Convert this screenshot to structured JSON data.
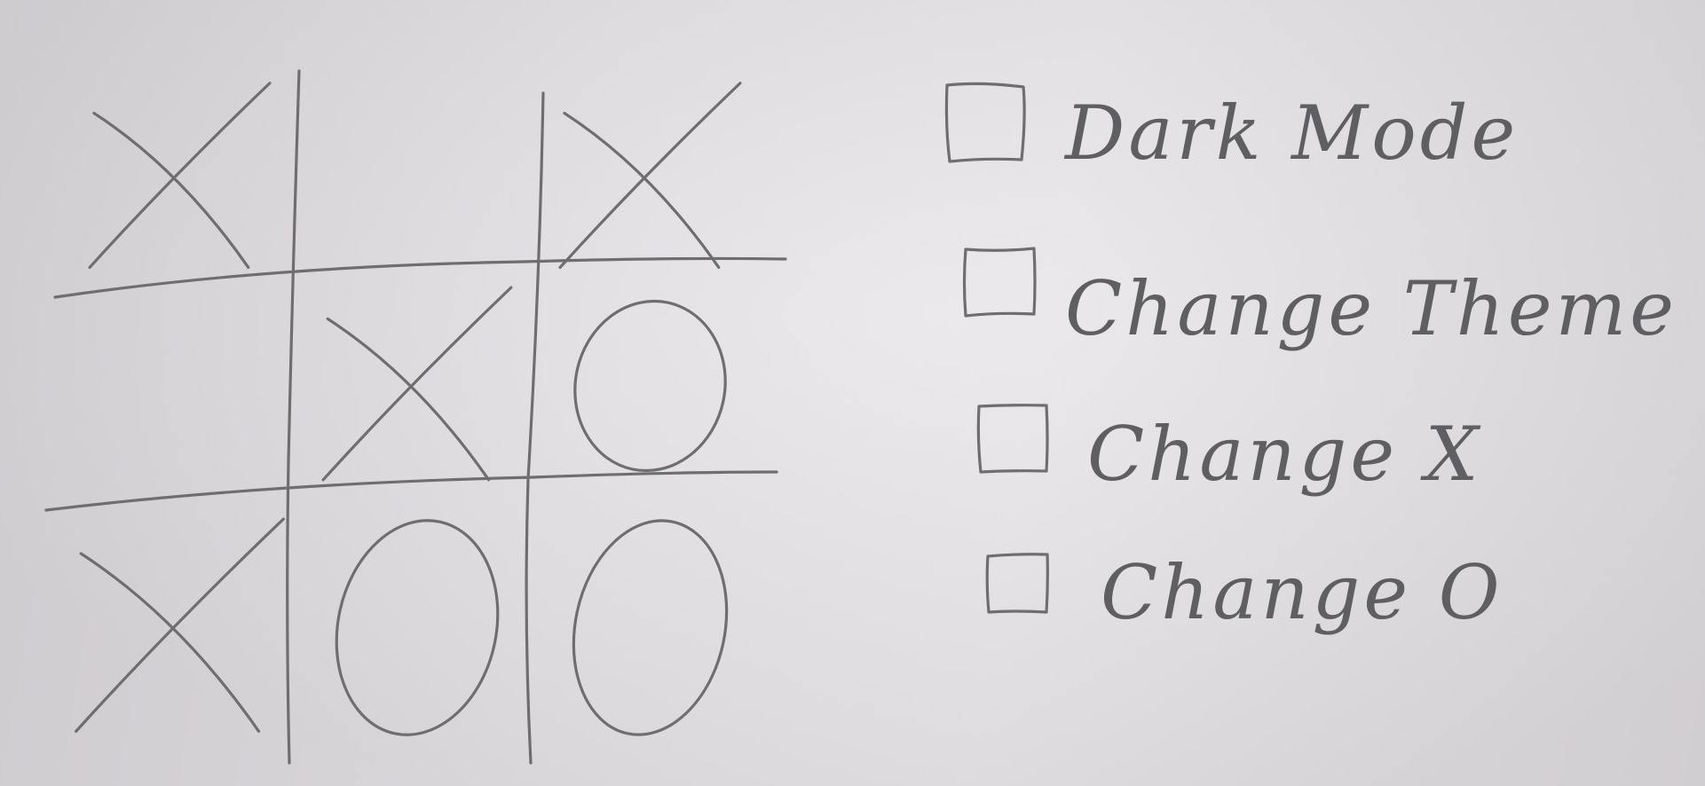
{
  "board": {
    "cells": [
      "X",
      "",
      "X",
      "",
      "X",
      "O",
      "X",
      "O",
      "O"
    ]
  },
  "options": [
    {
      "label": "Dark Mode",
      "checked": false
    },
    {
      "label": "Change Theme",
      "checked": false
    },
    {
      "label": "Change X",
      "checked": false
    },
    {
      "label": "Change O",
      "checked": false
    }
  ],
  "colors": {
    "pencil": "#6e6d70",
    "paper": "#e3e0e4"
  }
}
